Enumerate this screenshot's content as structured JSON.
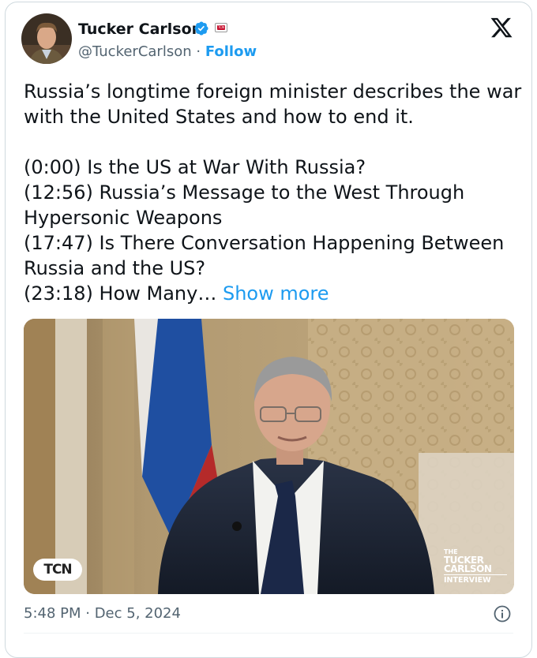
{
  "author": {
    "name": "Tucker Carlson",
    "handle": "@TuckerCarlson",
    "separator": "·",
    "follow_label": "Follow",
    "badge_text": "TCN"
  },
  "tweet": {
    "lines": [
      "Russia’s longtime foreign minister describes the war",
      "with the United States and how to end it.",
      "(0:00) Is the US at War With Russia?",
      "(12:56) Russia’s Message to the West Through",
      "Hypersonic Weapons",
      "(17:47) Is There Conversation Happening Between",
      "Russia and the US?",
      "(23:18) How Many…"
    ],
    "show_more": "Show more"
  },
  "media": {
    "left_logo": "TCN",
    "right_logo": {
      "line1": "THE",
      "line2": "TUCKER",
      "line3": "CARLSON",
      "line4": "INTERVIEW"
    }
  },
  "timestamp": "5:48 PM · Dec 5, 2024",
  "icons": {
    "verified": "verified-badge-icon",
    "x": "x-logo-icon",
    "info": "info-icon"
  },
  "colors": {
    "link": "#1d9bf0",
    "secondary_text": "#536471",
    "verified": "#1d9bf0"
  }
}
